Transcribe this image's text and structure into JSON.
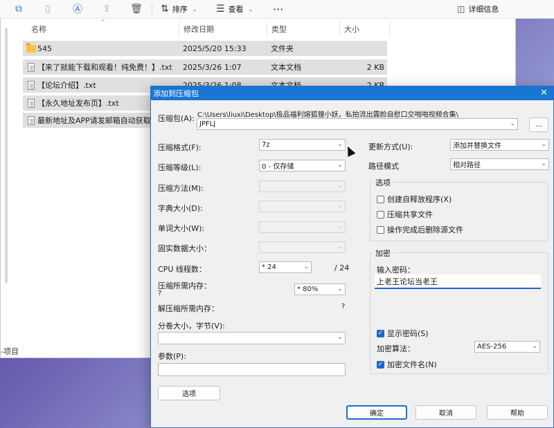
{
  "toolbar": {
    "sort_label": "排序",
    "view_label": "查看",
    "details_label": "详细信息"
  },
  "columns": [
    "名称",
    "修改日期",
    "类型",
    "大小"
  ],
  "files": [
    {
      "name": "545",
      "date": "2025/5/20 15:33",
      "type": "文件夹",
      "size": "",
      "icon": "folder-icon"
    },
    {
      "name": "【来了就能下载和观看！纯免费！】.txt",
      "date": "2025/3/26 1:07",
      "type": "文本文档",
      "size": "2 KB",
      "icon": "text-file-icon"
    },
    {
      "name": "【论坛介绍】.txt",
      "date": "2025/3/26 1:08",
      "type": "文本文档",
      "size": "2 KB",
      "icon": "text-file-icon"
    },
    {
      "name": "【永久地址发布页】.txt",
      "date": "",
      "type": "",
      "size": "",
      "icon": "text-file-icon"
    },
    {
      "name": "最新地址及APP请发邮箱自动获取!",
      "date": "",
      "type": "",
      "size": "",
      "icon": "text-file-icon"
    }
  ],
  "status_bar": "-项目",
  "dialog": {
    "title": "添加到压缩包",
    "archive_label": "压缩包(A):",
    "archive_path": "C:\\Users\\liuxi\\Desktop\\极品福利熔狐狸小妖，私拍流出露脸自慰口交啪啪视频合集\\",
    "archive_name": "JPFLJ",
    "browse_label": "...",
    "format_label": "压缩格式(F):",
    "format_value": "7z",
    "level_label": "压缩等级(L):",
    "level_value": "0 - 仅存储",
    "method_label": "压缩方法(M):",
    "dict_label": "字典大小(D):",
    "word_label": "单词大小(W):",
    "solid_label": "固实数据大小：",
    "cpu_label": "CPU 线程数：",
    "cpu_value": "* 24",
    "cpu_total": "/ 24",
    "mem_comp_label": "压缩所需内存：",
    "mem_comp_q": "?",
    "mem_value": "* 80%",
    "mem_decomp_label": "解压缩所需内存：",
    "mem_decomp_q": "?",
    "volume_label": "分卷大小，字节(V):",
    "params_label": "参数(P):",
    "options_button": "选项",
    "update_label": "更新方式(U):",
    "update_value": "添加并替换文件",
    "path_label": "路径模式",
    "path_value": "相对路径",
    "options_group": "选项",
    "opt_sfx": "创建自释放程序(X)",
    "opt_shared": "压缩共享文件",
    "opt_delete": "操作完成后删除源文件",
    "encrypt_group": "加密",
    "pwd_label": "输入密码：",
    "pwd_value": "上老王论坛当老王",
    "show_pwd": "显示密码(S)",
    "enc_method_label": "加密算法：",
    "enc_method_value": "AES-256",
    "enc_names": "加密文件名(N)",
    "ok": "确定",
    "cancel": "取消",
    "help": "帮助"
  }
}
